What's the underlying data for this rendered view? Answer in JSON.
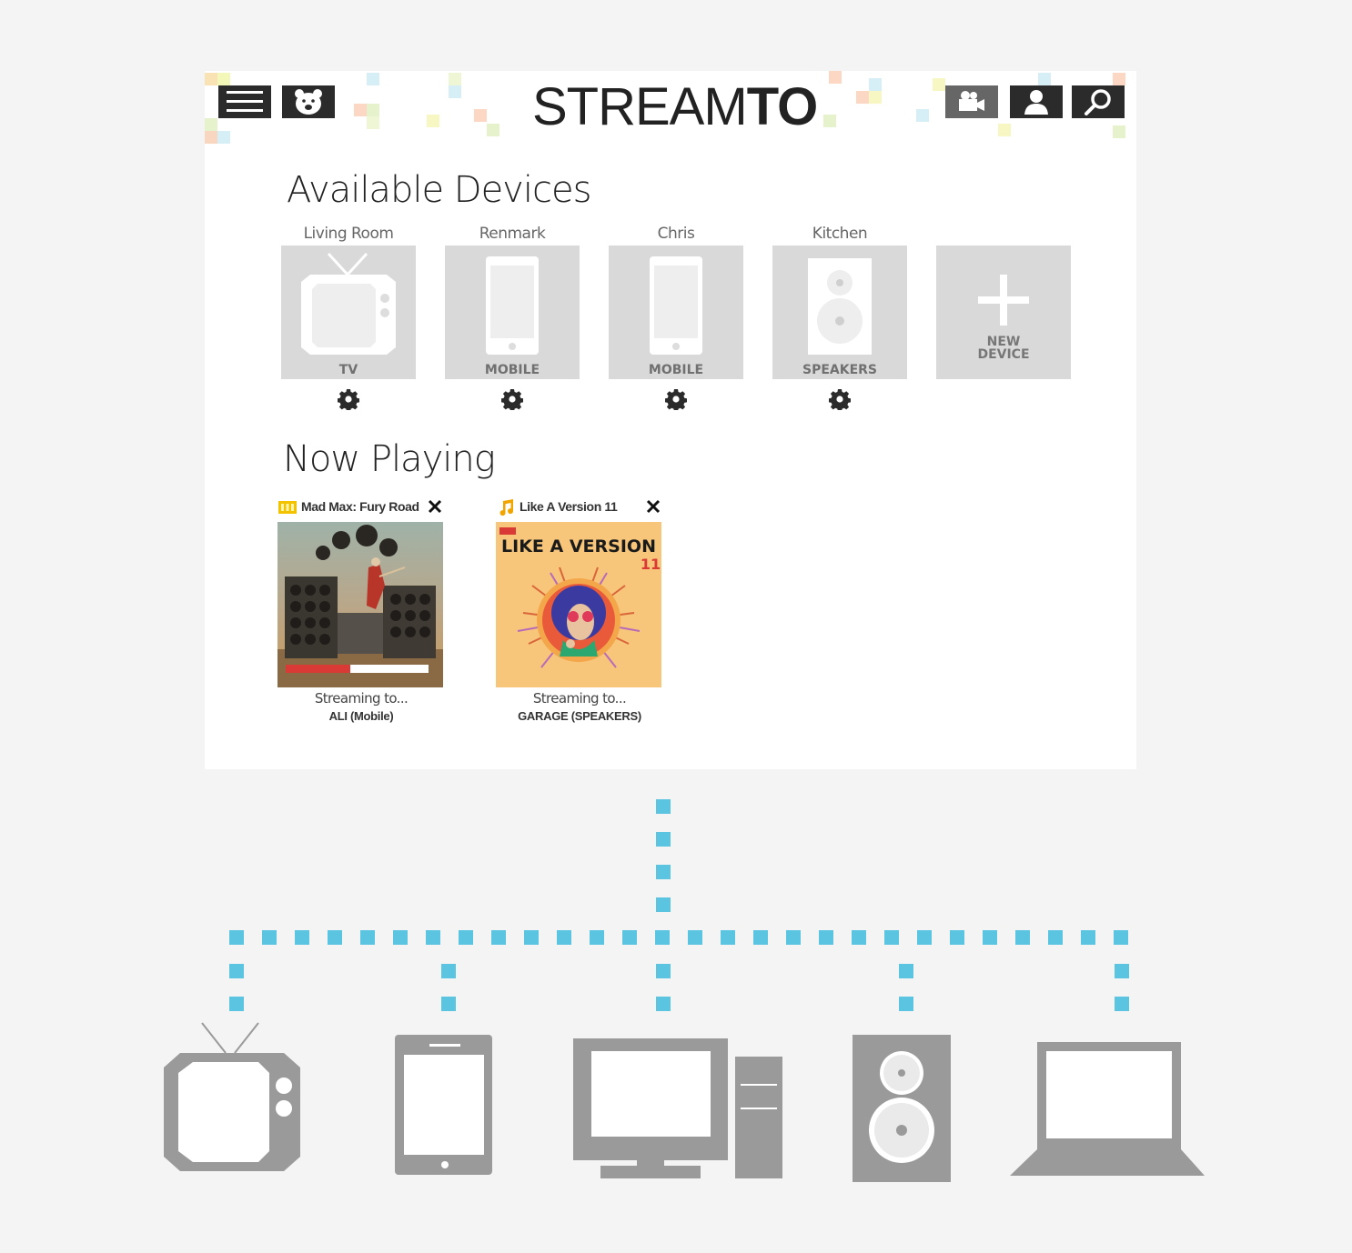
{
  "app": {
    "logo_light": "STREAM",
    "logo_bold": "TO",
    "header_buttons": {
      "menu": "menu-icon",
      "bear": "bear-icon",
      "camera": "video-camera-icon",
      "profile": "user-icon",
      "search": "search-icon"
    }
  },
  "available_devices": {
    "title": "Available Devices",
    "items": [
      {
        "name": "Living Room",
        "type": "TV",
        "icon": "tv-icon"
      },
      {
        "name": "Renmark",
        "type": "MOBILE",
        "icon": "mobile-icon"
      },
      {
        "name": "Chris",
        "type": "MOBILE",
        "icon": "mobile-icon"
      },
      {
        "name": "Kitchen",
        "type": "SPEAKERS",
        "icon": "speaker-icon"
      }
    ],
    "new_device_line1": "NEW",
    "new_device_line2": "DEVICE"
  },
  "now_playing": {
    "title": "Now Playing",
    "items": [
      {
        "title": "Mad Max: Fury Road",
        "kind": "film-icon",
        "streaming_label": "Streaming to...",
        "target": "ALI (Mobile)",
        "progress": 0.45
      },
      {
        "title": "Like A Version 11",
        "kind": "music-note-icon",
        "streaming_label": "Streaming to...",
        "target": "GARAGE (SPEAKERS)",
        "art_text_main": "LIKE A VERSION",
        "art_text_number": "11"
      }
    ]
  },
  "colors": {
    "accent_blue": "#5bc4e0",
    "device_gray": "#9a9a9a",
    "tile_gray": "#d9d9d9",
    "progress_red": "#d93a36",
    "header_dark": "#2b2b2b"
  },
  "diagram": {
    "devices": [
      "tv-icon",
      "tablet-icon",
      "desktop-computer-icon",
      "speaker-icon",
      "laptop-icon"
    ]
  }
}
